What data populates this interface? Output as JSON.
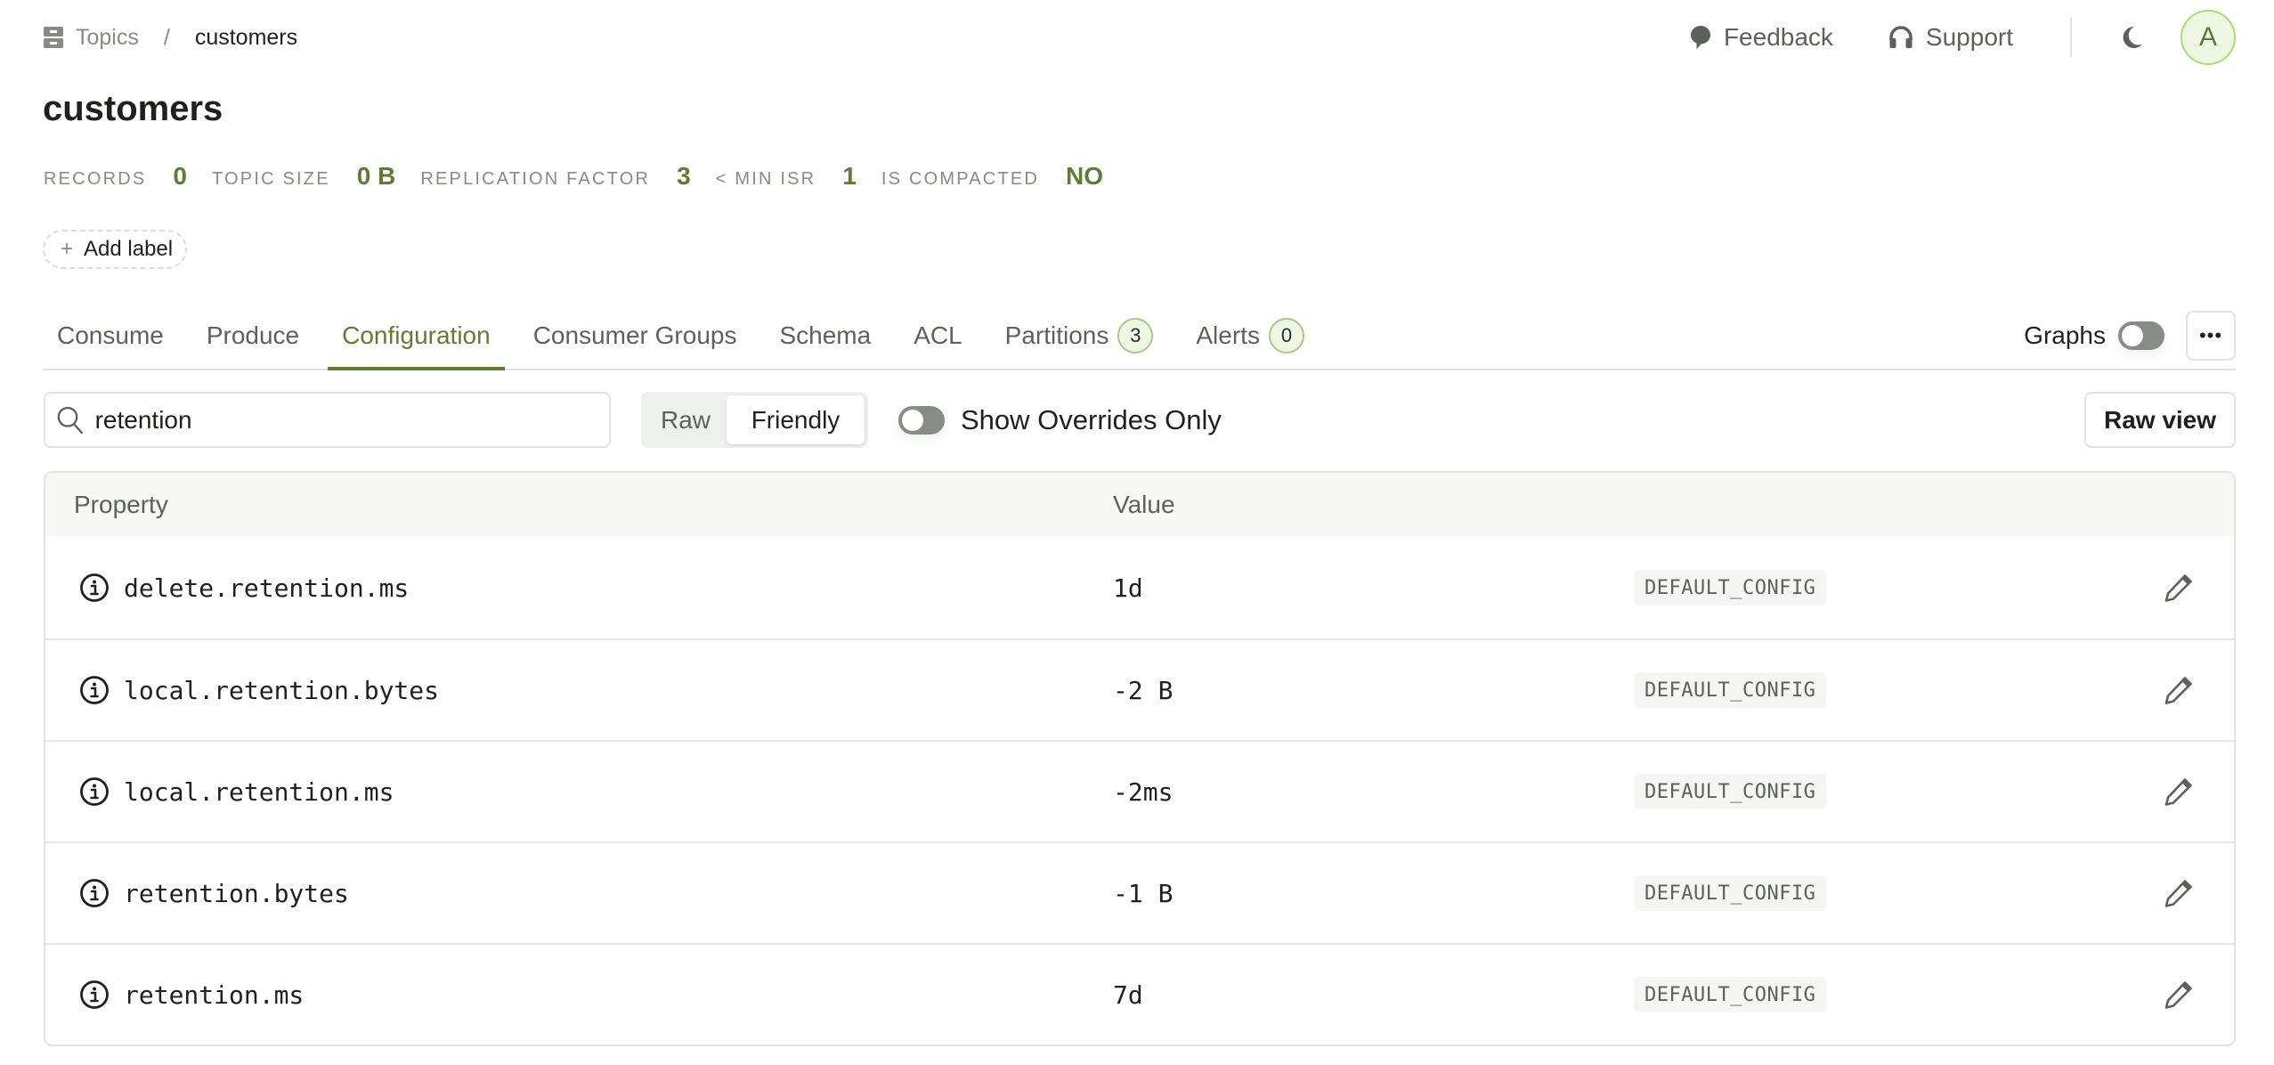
{
  "breadcrumb": {
    "icon": "topics-icon",
    "parent": "Topics",
    "separator": "/",
    "current": "customers"
  },
  "topbar": {
    "feedback_label": "Feedback",
    "support_label": "Support",
    "theme_icon": "moon-icon",
    "avatar_initial": "A"
  },
  "page": {
    "title": "customers"
  },
  "stats": [
    {
      "label": "RECORDS",
      "value": "0"
    },
    {
      "label": "TOPIC SIZE",
      "value": "0 B"
    },
    {
      "label": "REPLICATION FACTOR",
      "value": "3"
    },
    {
      "label": "< MIN ISR",
      "value": "1"
    },
    {
      "label": "IS COMPACTED",
      "value": "NO"
    }
  ],
  "add_label": {
    "plus": "+",
    "label": "Add label"
  },
  "tabs": [
    {
      "label": "Consume",
      "active": false
    },
    {
      "label": "Produce",
      "active": false
    },
    {
      "label": "Configuration",
      "active": true
    },
    {
      "label": "Consumer Groups",
      "active": false
    },
    {
      "label": "Schema",
      "active": false
    },
    {
      "label": "ACL",
      "active": false
    },
    {
      "label": "Partitions",
      "badge": "3",
      "active": false
    },
    {
      "label": "Alerts",
      "badge": "0",
      "active": false
    }
  ],
  "tabs_right": {
    "graphs_label": "Graphs",
    "graphs_enabled": false,
    "more_label": "•••"
  },
  "filters": {
    "search_value": "retention",
    "view_modes": [
      {
        "label": "Raw",
        "active": false
      },
      {
        "label": "Friendly",
        "active": true
      }
    ],
    "overrides_label": "Show Overrides Only",
    "overrides_enabled": false,
    "raw_view_label": "Raw view"
  },
  "table": {
    "columns": {
      "property": "Property",
      "value": "Value"
    },
    "rows": [
      {
        "property": "delete.retention.ms",
        "value": "1d",
        "source": "DEFAULT_CONFIG"
      },
      {
        "property": "local.retention.bytes",
        "value": "-2 B",
        "source": "DEFAULT_CONFIG"
      },
      {
        "property": "local.retention.ms",
        "value": "-2ms",
        "source": "DEFAULT_CONFIG"
      },
      {
        "property": "retention.bytes",
        "value": "-1 B",
        "source": "DEFAULT_CONFIG"
      },
      {
        "property": "retention.ms",
        "value": "7d",
        "source": "DEFAULT_CONFIG"
      }
    ]
  },
  "colors": {
    "accent": "#5e7c34",
    "badge_bg": "#eef6e4",
    "badge_border": "#a6cc84",
    "avatar_border": "#a9dc73",
    "muted_text": "#878a85",
    "border": "#e2e3e1"
  }
}
